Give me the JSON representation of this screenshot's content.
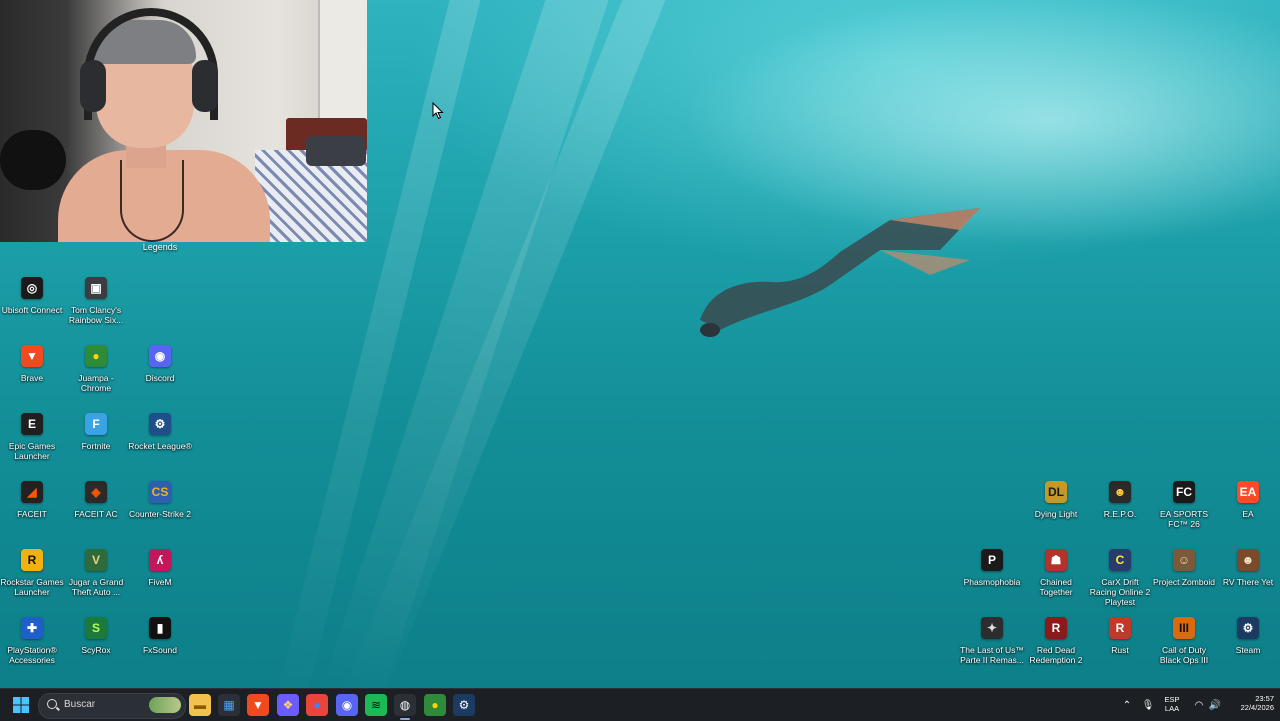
{
  "webcam_label": "Legends",
  "desktop": {
    "left_icons": [
      {
        "name": "ubisoft-connect-icon",
        "label": "Ubisoft Connect",
        "color": "#1a1a1a",
        "glyph": "◎",
        "fg": "#ffffff"
      },
      {
        "name": "rainbow-six-icon",
        "label": "Tom Clancy's Rainbow Six...",
        "color": "#3b3d42",
        "glyph": "▣",
        "fg": "#ffffff"
      },
      {
        "name": "brave-icon",
        "label": "Brave",
        "color": "#f04a1f",
        "glyph": "▼",
        "fg": "#ffffff"
      },
      {
        "name": "chrome-profile-icon",
        "label": "Juampa - Chrome",
        "color": "#2e8b3a",
        "glyph": "●",
        "fg": "#ffd400"
      },
      {
        "name": "discord-icon",
        "label": "Discord",
        "color": "#5865f2",
        "glyph": "◉",
        "fg": "#ffffff"
      },
      {
        "name": "epic-games-icon",
        "label": "Epic Games Launcher",
        "color": "#1f1f1f",
        "glyph": "E",
        "fg": "#ffffff"
      },
      {
        "name": "fortnite-icon",
        "label": "Fortnite",
        "color": "#3aa3e6",
        "glyph": "F",
        "fg": "#ffffff"
      },
      {
        "name": "rocket-league-icon",
        "label": "Rocket League®",
        "color": "#1f4f8a",
        "glyph": "⚙",
        "fg": "#ffffff"
      },
      {
        "name": "faceit-icon",
        "label": "FACEIT",
        "color": "#222222",
        "glyph": "◢",
        "fg": "#ff5500"
      },
      {
        "name": "faceit-ac-icon",
        "label": "FACEIT AC",
        "color": "#2a2a2a",
        "glyph": "◈",
        "fg": "#ff5500"
      },
      {
        "name": "counter-strike-icon",
        "label": "Counter-Strike 2",
        "color": "#2f5fb0",
        "glyph": "CS",
        "fg": "#f3b21a"
      },
      {
        "name": "rockstar-icon",
        "label": "Rockstar Games Launcher",
        "color": "#f2b10f",
        "glyph": "R",
        "fg": "#111111"
      },
      {
        "name": "gta-icon",
        "label": "Jugar a Grand Theft Auto ...",
        "color": "#2f6b3a",
        "glyph": "V",
        "fg": "#e7d08a"
      },
      {
        "name": "fivem-icon",
        "label": "FiveM",
        "color": "#c2185b",
        "glyph": "ʎ",
        "fg": "#ffffff"
      },
      {
        "name": "playstation-accessories-icon",
        "label": "PlayStation® Accessories",
        "color": "#1f5fc6",
        "glyph": "✚",
        "fg": "#ffffff"
      },
      {
        "name": "scyrox-icon",
        "label": "ScyRox",
        "color": "#1c7a3a",
        "glyph": "S",
        "fg": "#b8ff5a"
      },
      {
        "name": "fxsound-icon",
        "label": "FxSound",
        "color": "#111111",
        "glyph": "▮",
        "fg": "#ffffff"
      }
    ],
    "right_icons": [
      {
        "name": "dying-light-icon",
        "label": "Dying Light",
        "color": "#c39a2a",
        "glyph": "DL",
        "fg": "#1a1a1a"
      },
      {
        "name": "repo-icon",
        "label": "R.E.P.O.",
        "color": "#2a2a2a",
        "glyph": "☻",
        "fg": "#ffcc33"
      },
      {
        "name": "ea-fc-icon",
        "label": "EA SPORTS FC™ 26",
        "color": "#1a1a1a",
        "glyph": "FC",
        "fg": "#ffffff"
      },
      {
        "name": "ea-icon",
        "label": "EA",
        "color": "#ff4a2a",
        "glyph": "EA",
        "fg": "#ffffff"
      },
      {
        "name": "phasmophobia-icon",
        "label": "Phasmophobia",
        "color": "#1a1a1a",
        "glyph": "P",
        "fg": "#ffffff"
      },
      {
        "name": "chained-together-icon",
        "label": "Chained Together",
        "color": "#b3322b",
        "glyph": "☗",
        "fg": "#ffffff"
      },
      {
        "name": "carx-drift-icon",
        "label": "CarX Drift Racing Online 2 Playtest",
        "color": "#2a3c6b",
        "glyph": "C",
        "fg": "#ffee33"
      },
      {
        "name": "project-zomboid-icon",
        "label": "Project Zomboid",
        "color": "#7a5a3a",
        "glyph": "☺",
        "fg": "#f1d9a8"
      },
      {
        "name": "rv-there-yet-icon",
        "label": "RV There Yet",
        "color": "#7a4a2a",
        "glyph": "☻",
        "fg": "#f7e4c8"
      },
      {
        "name": "last-of-us-icon",
        "label": "The Last of Us™ Parte II Remas...",
        "color": "#2b2d2f",
        "glyph": "✦",
        "fg": "#dddddd"
      },
      {
        "name": "red-dead-icon",
        "label": "Red Dead Redemption 2",
        "color": "#8b1a1a",
        "glyph": "R",
        "fg": "#ffffff"
      },
      {
        "name": "rust-icon",
        "label": "Rust",
        "color": "#c0392b",
        "glyph": "R",
        "fg": "#ffffff"
      },
      {
        "name": "call-of-duty-icon",
        "label": "Call of Duty Black Ops III",
        "color": "#d86a12",
        "glyph": "III",
        "fg": "#111111"
      },
      {
        "name": "steam-desktop-icon",
        "label": "Steam",
        "color": "#1b3b62",
        "glyph": "⚙",
        "fg": "#ffffff"
      }
    ]
  },
  "taskbar": {
    "search_placeholder": "Buscar",
    "apps": [
      {
        "name": "file-explorer-icon",
        "color": "#f2c14e",
        "glyph": "▬",
        "fg": "#8a5a00"
      },
      {
        "name": "microsoft-store-icon",
        "color": "#2b2f36",
        "glyph": "▦",
        "fg": "#4aa3ff"
      },
      {
        "name": "brave-taskbar-icon",
        "color": "#f04a1f",
        "glyph": "▼",
        "fg": "#ffffff"
      },
      {
        "name": "copilot-icon",
        "color": "#6b5cff",
        "glyph": "❖",
        "fg": "#ffd36e"
      },
      {
        "name": "chrome-icon",
        "color": "#e8453c",
        "glyph": "●",
        "fg": "#4285f4"
      },
      {
        "name": "discord-taskbar-icon",
        "color": "#5865f2",
        "glyph": "◉",
        "fg": "#ffffff"
      },
      {
        "name": "spotify-icon",
        "color": "#1db954",
        "glyph": "≋",
        "fg": "#111111"
      },
      {
        "name": "obs-icon",
        "color": "#2b2f36",
        "glyph": "◍",
        "fg": "#ffffff"
      },
      {
        "name": "chrome-profile-taskbar-icon",
        "color": "#2e8b3a",
        "glyph": "●",
        "fg": "#ffd400"
      },
      {
        "name": "steam-taskbar-icon",
        "color": "#1b3b62",
        "glyph": "⚙",
        "fg": "#ffffff"
      }
    ],
    "lang_top": "ESP",
    "lang_bottom": "LAA",
    "time": "23:57",
    "date": "22/4/2026"
  }
}
